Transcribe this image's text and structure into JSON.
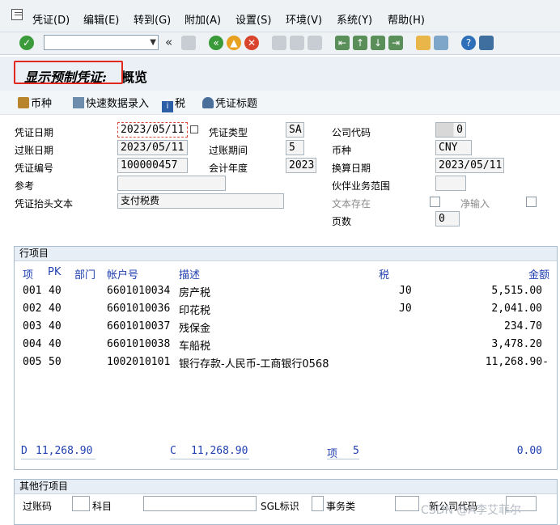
{
  "menu": {
    "items": [
      "凭证(D)",
      "编辑(E)",
      "转到(G)",
      "附加(A)",
      "设置(S)",
      "环境(V)",
      "系统(Y)",
      "帮助(H)"
    ]
  },
  "toolbar": {
    "nav_back_label": "«"
  },
  "title": {
    "part1": "显示预制凭证:",
    "part2": "概览"
  },
  "appbar": {
    "currency_btn": "币种",
    "fast_entry_btn": "快速数据录入",
    "tax_btn": "税",
    "header_btn": "凭证标题"
  },
  "header": {
    "doc_date_label": "凭证日期",
    "doc_date": "2023/05/11",
    "posting_date_label": "过账日期",
    "posting_date": "2023/05/11",
    "doc_number_label": "凭证编号",
    "doc_number": "100000457",
    "reference_label": "参考",
    "reference": "",
    "header_text_label": "凭证抬头文本",
    "header_text": "支付税费",
    "doc_type_label": "凭证类型",
    "doc_type": "SA",
    "period_label": "过账期间",
    "period": "5",
    "fiscal_year_label": "会计年度",
    "fiscal_year": "2023",
    "company_code_label": "公司代码",
    "company_code": "0",
    "currency_label": "币种",
    "currency": "CNY",
    "translation_date_label": "换算日期",
    "translation_date": "2023/05/11",
    "trading_partner_label": "伙伴业务范围",
    "trading_partner": "",
    "text_exists_label": "文本存在",
    "net_entry_label": "净输入",
    "pages_label": "页数",
    "pages": "0"
  },
  "line_items": {
    "title": "行项目",
    "columns": {
      "item": "项",
      "pk": "PK",
      "dept": "部门",
      "account": "帐户号",
      "desc": "描述",
      "tax": "税",
      "amount": "金额"
    },
    "rows": [
      {
        "item": "001",
        "pk": "40",
        "account": "6601010034",
        "desc": "房产税",
        "tax": "J0",
        "amount": "5,515.00"
      },
      {
        "item": "002",
        "pk": "40",
        "account": "6601010036",
        "desc": "印花税",
        "tax": "J0",
        "amount": "2,041.00"
      },
      {
        "item": "003",
        "pk": "40",
        "account": "6601010037",
        "desc": "残保金",
        "tax": "",
        "amount": "234.70"
      },
      {
        "item": "004",
        "pk": "40",
        "account": "6601010038",
        "desc": "车船税",
        "tax": "",
        "amount": "3,478.20"
      },
      {
        "item": "005",
        "pk": "50",
        "account": "1002010101",
        "desc": "银行存款-人民币-工商银行0568",
        "tax": "",
        "amount": "11,268.90-"
      }
    ],
    "totals": {
      "debit_label": "D",
      "debit": "11,268.90",
      "credit_label": "C",
      "credit": "11,268.90",
      "count_label": "项",
      "count": "5",
      "balance": "0.00"
    }
  },
  "other_items": {
    "title": "其他行项目",
    "posting_key_label": "过账码",
    "account_label": "科目",
    "sgl_label": "SGL标识",
    "trans_type_label": "事务类",
    "new_company_label": "新公司代码"
  },
  "watermark": "CSDN @A李艾菲尔",
  "colors": {
    "highlight": "#e0281f",
    "column_header": "#1f3fb0",
    "group_header": "#e7eef5"
  }
}
